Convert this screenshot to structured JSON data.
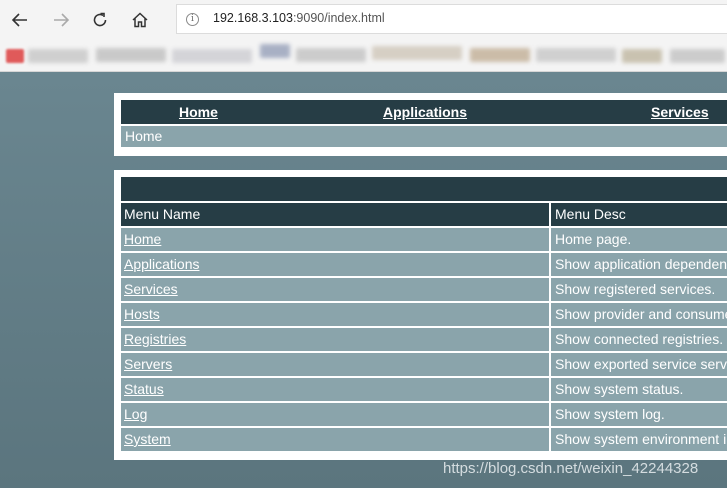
{
  "browser": {
    "url_host": "192.168.3.103",
    "url_rest": ":9090/index.html"
  },
  "nav": {
    "home": "Home",
    "applications": "Applications",
    "services": "Services"
  },
  "breadcrumb": "Home",
  "table": {
    "headers": [
      "Menu Name",
      "Menu Desc"
    ],
    "rows": [
      {
        "name": "Home",
        "desc": "Home page."
      },
      {
        "name": "Applications",
        "desc": "Show application dependencies."
      },
      {
        "name": "Services",
        "desc": "Show registered services."
      },
      {
        "name": "Hosts",
        "desc": "Show provider and consumer hosts"
      },
      {
        "name": "Registries",
        "desc": "Show connected registries."
      },
      {
        "name": "Servers",
        "desc": "Show exported service servers."
      },
      {
        "name": "Status",
        "desc": "Show system status."
      },
      {
        "name": "Log",
        "desc": "Show system log."
      },
      {
        "name": "System",
        "desc": "Show system environment information."
      }
    ]
  },
  "watermark": "https://blog.csdn.net/weixin_42244328"
}
